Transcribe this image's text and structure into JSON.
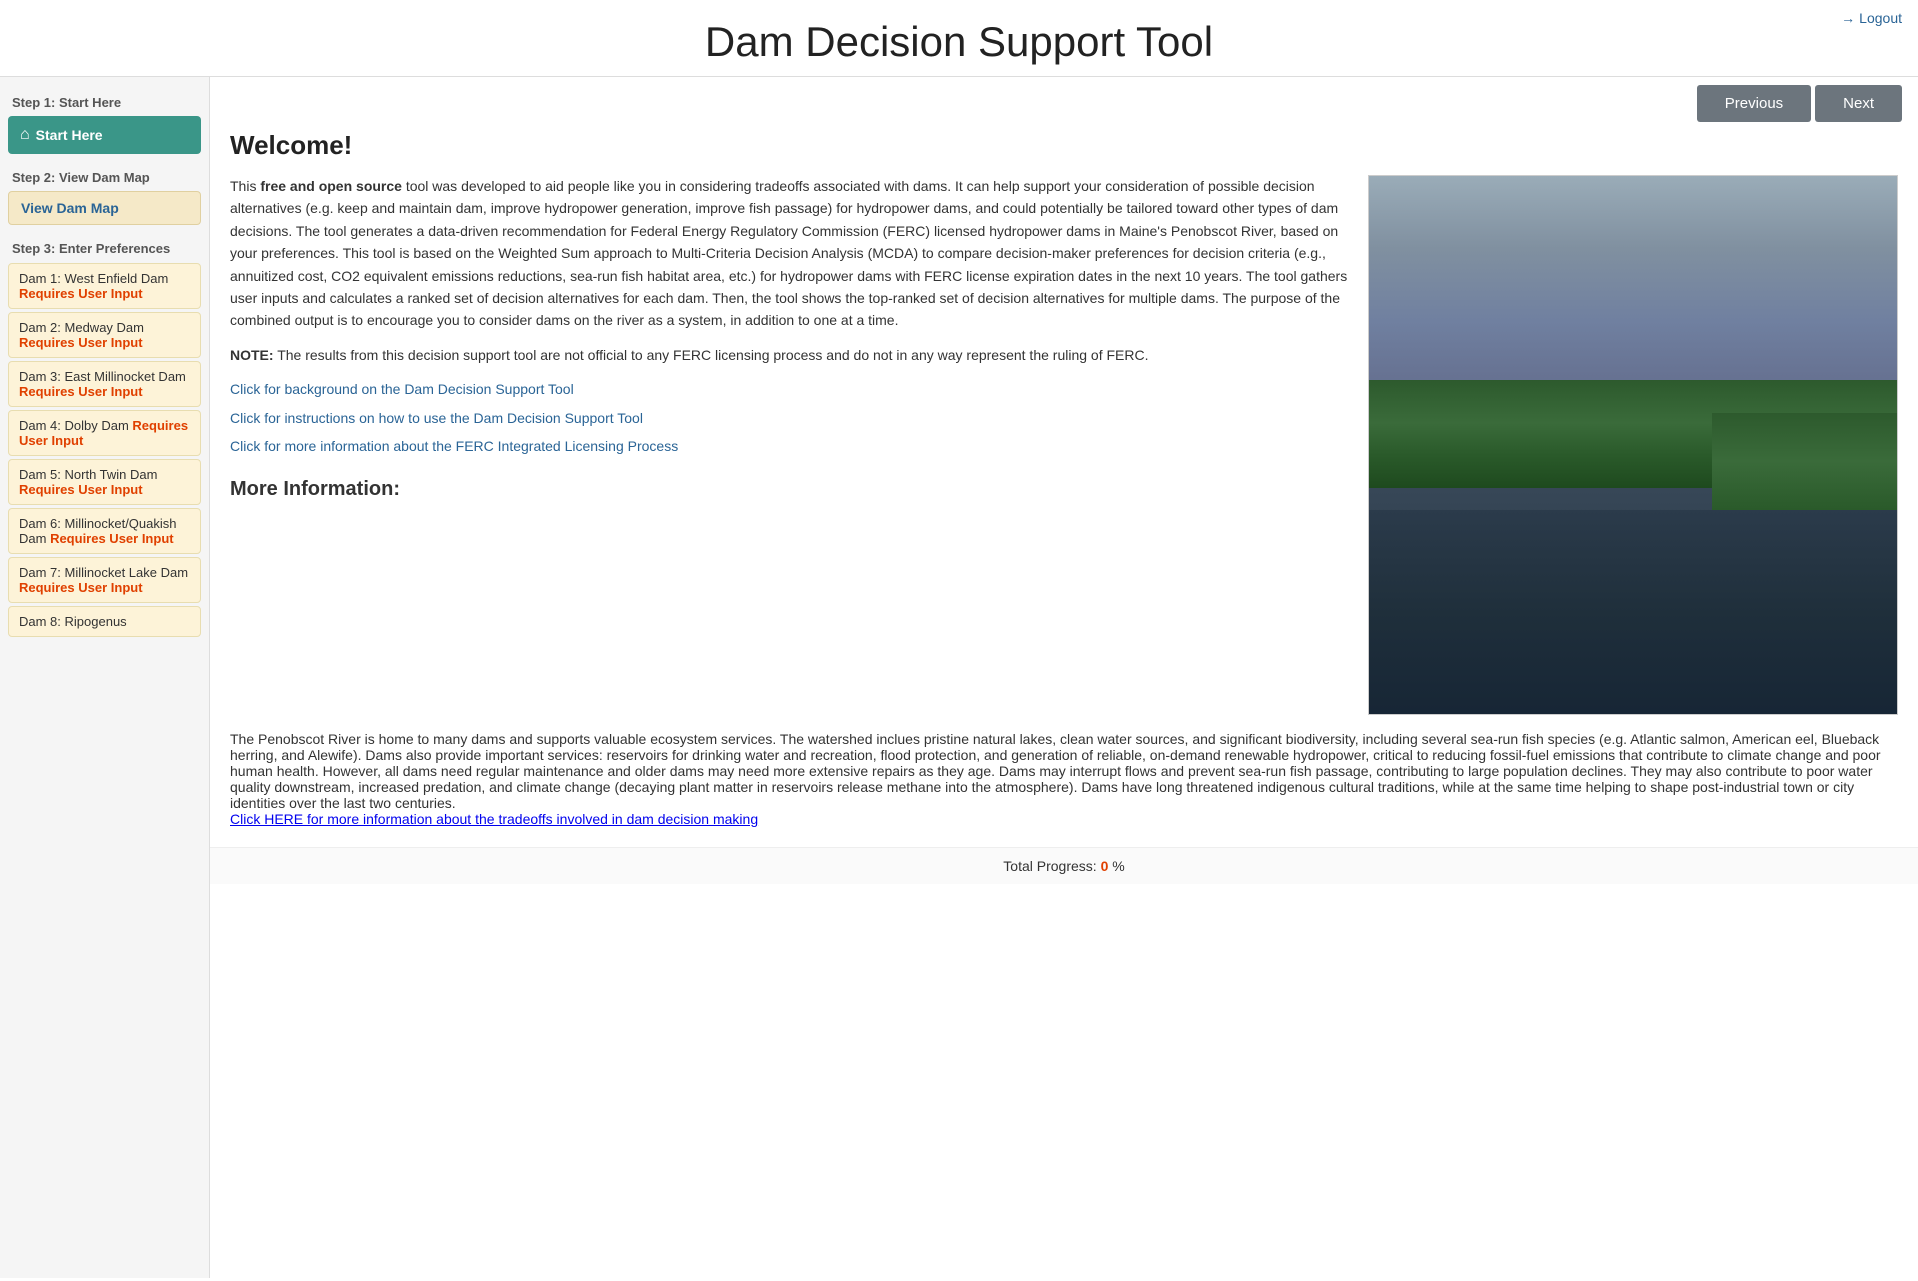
{
  "header": {
    "title": "Dam Decision Support Tool",
    "logout_label": "Logout"
  },
  "nav": {
    "previous_label": "Previous",
    "next_label": "Next"
  },
  "sidebar": {
    "step1_label": "Step 1: Start Here",
    "start_here_label": "Start Here",
    "step2_label": "Step 2: View Dam Map",
    "view_dam_map_label": "View Dam Map",
    "step3_label": "Step 3: Enter Preferences",
    "dams": [
      {
        "name": "Dam 1: West Enfield Dam",
        "status": "Requires User Input"
      },
      {
        "name": "Dam 2: Medway Dam",
        "status": "Requires User Input"
      },
      {
        "name": "Dam 3: East Millinocket Dam",
        "status": "Requires User Input"
      },
      {
        "name": "Dam 4: Dolby Dam",
        "status": "Requires User Input"
      },
      {
        "name": "Dam 5: North Twin Dam",
        "status": "Requires User Input"
      },
      {
        "name": "Dam 6: Millinocket/Quakish Dam",
        "status": "Requires User Input"
      },
      {
        "name": "Dam 7: Millinocket Lake Dam",
        "status": "Requires User Input"
      },
      {
        "name": "Dam 8: Ripogenus",
        "status": ""
      }
    ]
  },
  "content": {
    "welcome_title": "Welcome!",
    "intro_para1_pre": "This ",
    "intro_bold": "free and open source",
    "intro_para1_post": " tool was developed to aid people like you in considering tradeoffs associated with dams. It can help support your consideration of possible decision alternatives (e.g. keep and maintain dam, improve hydropower generation, improve fish passage) for hydropower dams, and could potentially be tailored toward other types of dam decisions. The tool generates a data-driven recommendation for Federal Energy Regulatory Commission (FERC) licensed hydropower dams in Maine's Penobscot River, based on your preferences. This tool is based on the Weighted Sum approach to Multi-Criteria Decision Analysis (MCDA) to compare decision-maker preferences for decision criteria (e.g., annuitized cost, CO2 equivalent emissions reductions, sea-run fish habitat area, etc.) for hydropower dams with FERC license expiration dates in the next 10 years. The tool gathers user inputs and calculates a ranked set of decision alternatives for each dam. Then, the tool shows the top-ranked set of decision alternatives for multiple dams. The purpose of the combined output is to encourage you to consider dams on the river as a system, in addition to one at a time.",
    "note_text": "NOTE: The results from this decision support tool are not official to any FERC licensing process and do not in any way represent the ruling of FERC.",
    "link1": "Click for background on the Dam Decision Support Tool",
    "link2": "Click for instructions on how to use the Dam Decision Support Tool",
    "link3": "Click for more information about the FERC Integrated Licensing Process",
    "more_info_title": "More Information:",
    "more_info_para": "The Penobscot River is home to many dams and supports valuable ecosystem services. The watershed inclues pristine natural lakes, clean water sources, and significant biodiversity, including several sea-run fish species (e.g. Atlantic salmon, American eel, Blueback herring, and Alewife). Dams also provide important services: reservoirs for drinking water and recreation, flood protection, and generation of reliable, on-demand renewable hydropower, critical to reducing fossil-fuel emissions that contribute to climate change and poor human health. However, all dams need regular maintenance and older dams may need more extensive repairs as they age. Dams may interrupt flows and prevent sea-run fish passage, contributing to large population declines. They may also contribute to poor water quality downstream, increased predation, and climate change (decaying plant matter in reservoirs release methane into the atmosphere). Dams have long threatened indigenous cultural traditions, while at the same time helping to shape post-industrial town or city identities over the last two centuries.",
    "more_info_link": "Click HERE for more information about the tradeoffs involved in dam decision making",
    "progress_label": "Total Progress:",
    "progress_value": "0",
    "progress_unit": "%"
  }
}
